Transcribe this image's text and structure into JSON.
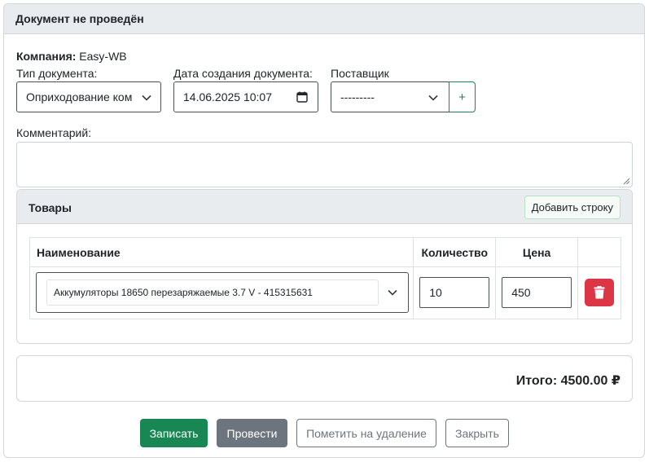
{
  "header": {
    "title": "Документ не проведён"
  },
  "company": {
    "label": "Компания:",
    "value": "Easy-WB"
  },
  "fields": {
    "doc_type": {
      "label": "Тип документа:",
      "value": "Оприходование ком"
    },
    "date": {
      "label": "Дата создания документа:",
      "value": "14.06.2025 10:07"
    },
    "supplier": {
      "label": "Поставщик",
      "value": "---------",
      "add_label": "+"
    },
    "comment": {
      "label": "Комментарий:",
      "value": ""
    }
  },
  "goods": {
    "title": "Товары",
    "add_row_label": "Добавить строку",
    "columns": [
      "Наименование",
      "Количество",
      "Цена"
    ],
    "rows": [
      {
        "name": "Аккумуляторы 18650 перезаряжаемые 3.7 V - 415315631",
        "quantity": "10",
        "price": "450"
      }
    ]
  },
  "total": {
    "text": "Итого: 4500.00 ₽"
  },
  "actions": {
    "save": "Записать",
    "post": "Провести",
    "mark_delete": "Пометить на удаление",
    "close": "Закрыть"
  },
  "colors": {
    "primary": "#198754",
    "secondary": "#6c757d",
    "danger": "#dc3545",
    "header_bg": "#e9ecef"
  },
  "icons": {
    "dropdown": "chevron-down-icon",
    "calendar": "calendar-icon",
    "delete": "trash-icon",
    "resize": "resize-handle-icon"
  }
}
